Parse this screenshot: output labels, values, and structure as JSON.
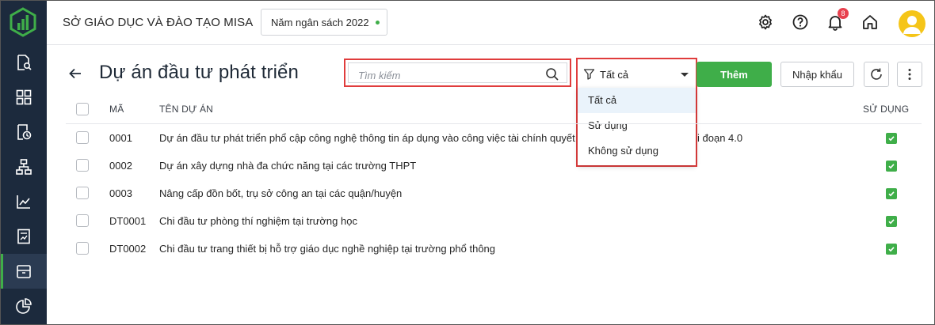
{
  "header": {
    "org_title": "SỞ GIÁO DỤC VÀ ĐÀO TẠO MISA",
    "budget_year_label": "Năm ngân sách 2022",
    "notification_count": "8"
  },
  "sidebar": {
    "items": [
      {
        "icon": "search-document-icon"
      },
      {
        "icon": "dashboard-icon"
      },
      {
        "icon": "document-clock-icon"
      },
      {
        "icon": "hierarchy-icon"
      },
      {
        "icon": "line-chart-icon"
      },
      {
        "icon": "report-icon"
      },
      {
        "icon": "catalog-box-icon"
      },
      {
        "icon": "pie-chart-icon"
      }
    ],
    "active_index": 6
  },
  "page": {
    "title": "Dự án đầu tư phát triển",
    "search_placeholder": "Tìm kiếm",
    "filter_value": "Tất cả",
    "filter_options": [
      "Tất cả",
      "Sử dụng",
      "Không sử dụng"
    ],
    "add_label": "Thêm",
    "import_label": "Nhập khẩu"
  },
  "table": {
    "headers": {
      "code": "MÃ",
      "name": "TÊN DỰ ÁN",
      "used": "SỬ DỤNG"
    },
    "rows": [
      {
        "code": "0001",
        "name": "Dự án đầu tư phát triển phổ cập công nghệ thông tin áp dụng vào công việc tài chính quyết t",
        "name_tail": "i đoạn 4.0",
        "used": true
      },
      {
        "code": "0002",
        "name": "Dự án xây dựng nhà đa chức năng tại các trường THPT",
        "name_tail": "",
        "used": true
      },
      {
        "code": "0003",
        "name": "Nâng cấp đồn bốt, trụ sở công an tại các quận/huyện",
        "name_tail": "",
        "used": true
      },
      {
        "code": "DT0001",
        "name": "Chi đầu tư phòng thí nghiệm tại trường học",
        "name_tail": "",
        "used": true
      },
      {
        "code": "DT0002",
        "name": "Chi đầu tư trang thiết bị hỗ trợ giáo dục nghề nghiệp tại trường phổ thông",
        "name_tail": "",
        "used": true
      }
    ]
  },
  "colors": {
    "sidebar_bg": "#1c2a3d",
    "brand_green": "#3fae49",
    "highlight_red": "#e03c3c",
    "badge_red": "#e8414e",
    "avatar_yellow": "#f5c518"
  }
}
